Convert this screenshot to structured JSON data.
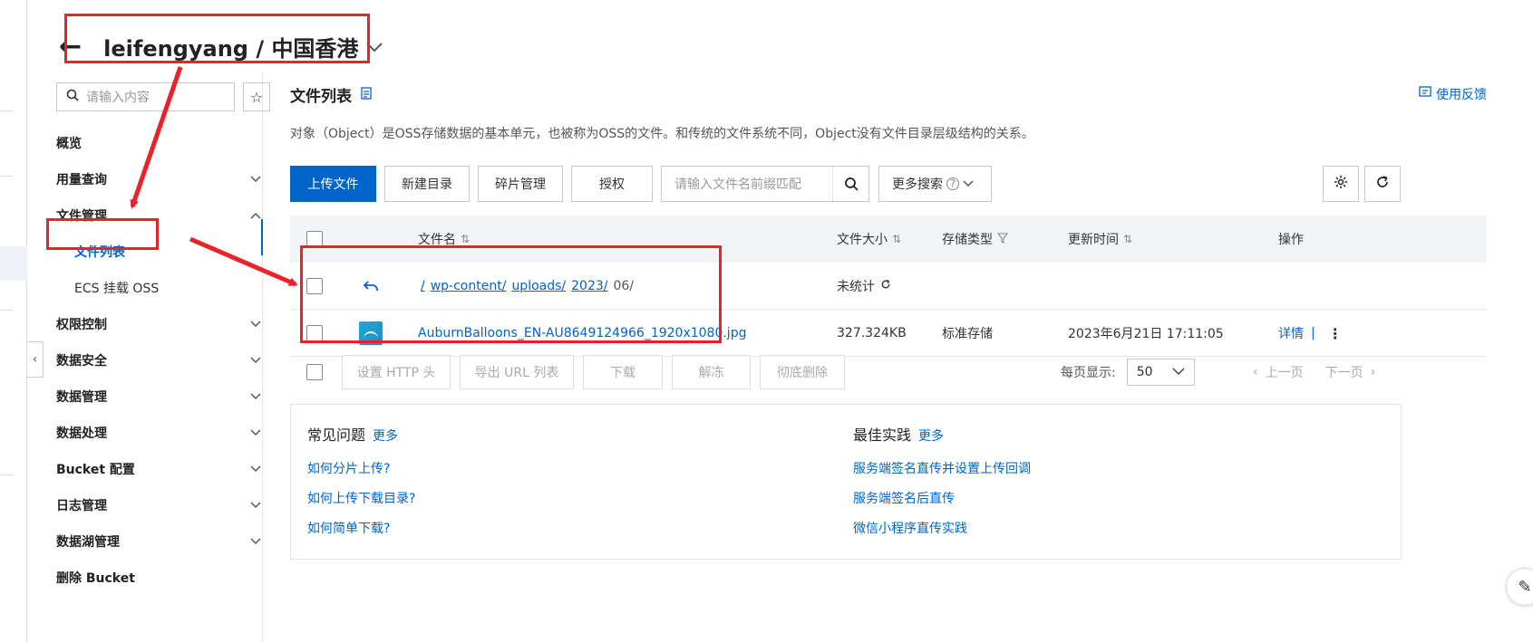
{
  "header": {
    "back_icon": "back-arrow-icon",
    "title": "leifengyang / 中国香港"
  },
  "sidebar": {
    "search_placeholder": "请输入内容",
    "items": [
      {
        "label": "概览",
        "chevron": ""
      },
      {
        "label": "用量查询",
        "chevron": "down"
      },
      {
        "label": "文件管理",
        "chevron": "up"
      },
      {
        "label": "文件列表",
        "sub": true,
        "active": true
      },
      {
        "label": "ECS 挂载 OSS",
        "sub": true
      },
      {
        "label": "权限控制",
        "chevron": "down"
      },
      {
        "label": "数据安全",
        "chevron": "down"
      },
      {
        "label": "数据管理",
        "chevron": "down"
      },
      {
        "label": "数据处理",
        "chevron": "down"
      },
      {
        "label": "Bucket 配置",
        "chevron": "down"
      },
      {
        "label": "日志管理",
        "chevron": "down"
      },
      {
        "label": "数据湖管理",
        "chevron": "down"
      },
      {
        "label": "删除 Bucket",
        "chevron": ""
      }
    ]
  },
  "main": {
    "title": "文件列表",
    "feedback": "使用反馈",
    "description": "对象（Object）是OSS存储数据的基本单元，也被称为OSS的文件。和传统的文件系统不同，Object没有文件目录层级结构的关系。",
    "toolbar": {
      "upload": "上传文件",
      "new_dir": "新建目录",
      "fragments": "碎片管理",
      "authorize": "授权",
      "search_placeholder": "请输入文件名前缀匹配",
      "more_search": "更多搜索"
    },
    "table": {
      "headers": {
        "name": "文件名",
        "size": "文件大小",
        "storage": "存储类型",
        "updated": "更新时间",
        "actions": "操作"
      },
      "path_row": {
        "segments": [
          "/",
          "wp-content/",
          "uploads/",
          "2023/"
        ],
        "current": "06/",
        "size": "未统计"
      },
      "rows": [
        {
          "name": "AuburnBalloons_EN-AU8649124966_1920x1080.jpg",
          "size": "327.324KB",
          "storage": "标准存储",
          "updated": "2023年6月21日 17:11:05",
          "action": "详情",
          "separator": "|"
        }
      ]
    },
    "bulk": {
      "http_header": "设置 HTTP 头",
      "export_url": "导出 URL 列表",
      "download": "下载",
      "unfreeze": "解冻",
      "delete": "彻底删除"
    },
    "pagination": {
      "page_size_label": "每页显示:",
      "page_size": "50",
      "prev": "上一页",
      "next": "下一页"
    },
    "help": {
      "faq_title": "常见问题",
      "faq_more": "更多",
      "faq_links": [
        "如何分片上传?",
        "如何上传下载目录?",
        "如何简单下载?"
      ],
      "best_title": "最佳实践",
      "best_more": "更多",
      "best_links": [
        "服务端签名直传并设置上传回调",
        "服务端签名后直传",
        "微信小程序直传实践"
      ]
    }
  },
  "annotation_color": "#e8232a",
  "accent_color": "#0064c8"
}
